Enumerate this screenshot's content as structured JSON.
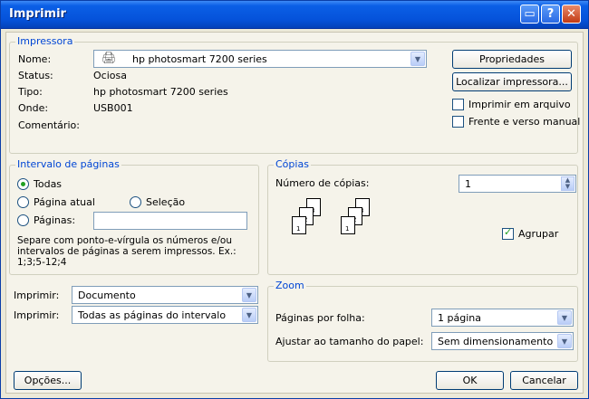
{
  "window": {
    "title": "Imprimir"
  },
  "printer": {
    "legend": "Impressora",
    "name_label": "Nome:",
    "name_value": "hp photosmart 7200 series",
    "status_label": "Status:",
    "status_value": "Ociosa",
    "type_label": "Tipo:",
    "type_value": "hp photosmart 7200 series",
    "where_label": "Onde:",
    "where_value": "USB001",
    "comment_label": "Comentário:",
    "properties_button": "Propriedades",
    "find_printer_button": "Localizar impressora...",
    "print_to_file_label": "Imprimir em arquivo",
    "duplex_label": "Frente e verso manual",
    "print_to_file_checked": false,
    "duplex_checked": false
  },
  "page_range": {
    "legend": "Intervalo de páginas",
    "all_label": "Todas",
    "current_label": "Página atual",
    "selection_label": "Seleção",
    "pages_label": "Páginas:",
    "pages_value": "",
    "hint": "Separe com ponto-e-vírgula os números e/ou intervalos de páginas a serem impressos.  Ex.: 1;3;5-12;4",
    "selected": "all"
  },
  "copies": {
    "legend": "Cópias",
    "count_label": "Número de cópias:",
    "count_value": "1",
    "collate_label": "Agrupar",
    "collate_checked": true,
    "page_numbers": [
      "3",
      "2",
      "1",
      "3",
      "2",
      "1"
    ]
  },
  "print_what": {
    "label": "Imprimir:",
    "value": "Documento"
  },
  "print_range": {
    "label": "Imprimir:",
    "value": "Todas as páginas do intervalo"
  },
  "zoom": {
    "legend": "Zoom",
    "pages_per_sheet_label": "Páginas por folha:",
    "pages_per_sheet_value": "1 página",
    "scale_label": "Ajustar ao tamanho do papel:",
    "scale_value": "Sem dimensionamento"
  },
  "footer": {
    "options_button": "Opções...",
    "ok_button": "OK",
    "cancel_button": "Cancelar"
  },
  "colors": {
    "titlebar": "#0552da",
    "legend": "#0046d5",
    "check": "#21a121"
  }
}
